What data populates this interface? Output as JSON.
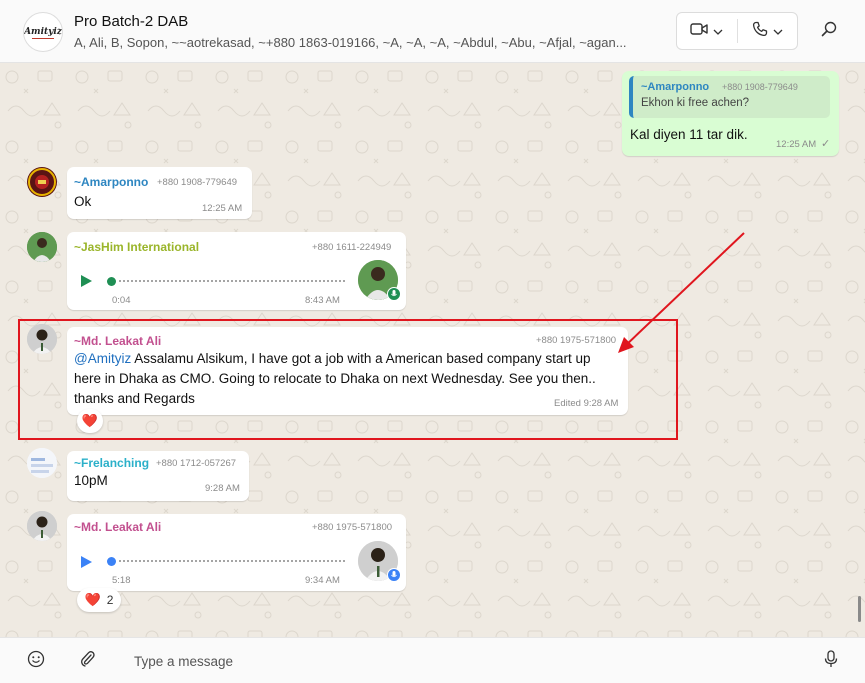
{
  "header": {
    "group_logo_text": "Amityiz",
    "title": "Pro Batch-2 DAB",
    "members": "A, Ali, B, Sopon, ~~aotrekasad, ~+880 1863-019166, ~A, ~A, ~A, ~Abdul, ~Abu, ~Afjal, ~agan..."
  },
  "messages": {
    "outgoing": {
      "quote_sender": "~Amarponno",
      "quote_phone": "+880 1908-779649",
      "quote_text": "Ekhon ki free achen?",
      "text": "Kal diyen 11 tar dik.",
      "time": "12:25 AM",
      "tick": "✓"
    },
    "m1": {
      "sender": "~Amarponno",
      "phone": "+880 1908-779649",
      "text": "Ok",
      "time": "12:25 AM"
    },
    "m2": {
      "sender": "~JasHim International",
      "phone": "+880 1611-224949",
      "duration": "0:04",
      "time": "8:43 AM"
    },
    "m3": {
      "sender": "~Md. Leakat Ali",
      "phone": "+880 1975-571800",
      "mention": "@Amityiz",
      "text_line1": " Assalamu Alsikum, I have got a job with a American based company start up",
      "text_line2": "here in Dhaka as CMO. Going to relocate to Dhaka on next  Wednesday. See you then..",
      "text_line3": "thanks and Regards",
      "time": "Edited 9:28 AM",
      "reaction": "❤️"
    },
    "m4": {
      "sender": "~Frelanching",
      "phone": "+880 1712-057267",
      "text": "10pM",
      "time": "9:28 AM"
    },
    "m5": {
      "sender": "~Md. Leakat Ali",
      "phone": "+880 1975-571800",
      "duration": "5:18",
      "time": "9:34 AM",
      "reaction": "❤️",
      "reaction_count": "2"
    }
  },
  "input": {
    "placeholder": "Type a message"
  },
  "colors": {
    "accent_green": "#25d366",
    "outgoing_bubble": "#d9fdd3",
    "play_blue": "#3b82f6",
    "play_green": "#1f8f54",
    "highlight_red": "#e0161e",
    "sender_amarponno": "#2e86c1",
    "sender_jashim": "#9ab52a",
    "sender_leakat": "#c2508f",
    "sender_frelanching": "#2bb0c9"
  }
}
